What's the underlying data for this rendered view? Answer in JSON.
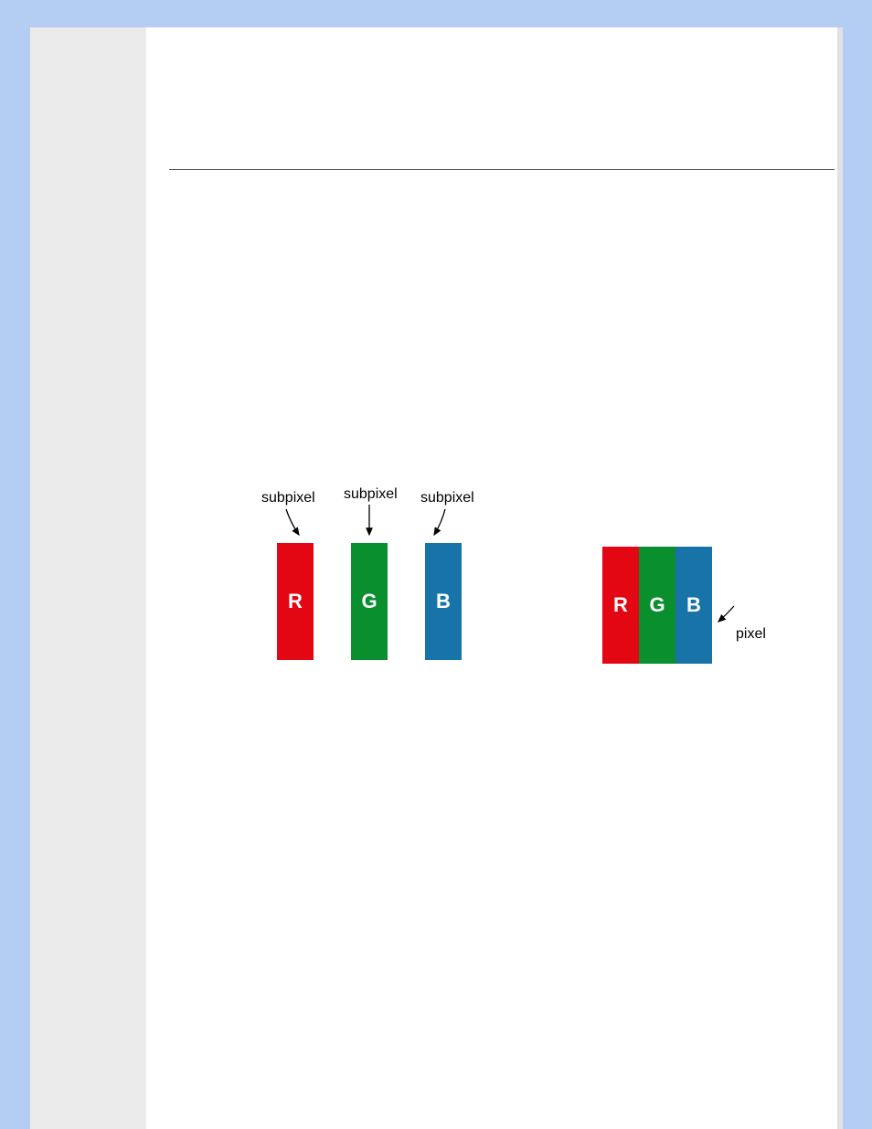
{
  "diagram": {
    "subpixel_label_r": "subpixel",
    "subpixel_label_g": "subpixel",
    "subpixel_label_b": "subpixel",
    "pixel_label": "pixel",
    "letters": {
      "r": "R",
      "g": "G",
      "b": "B"
    },
    "colors": {
      "r": "#e30613",
      "g": "#0a8f2f",
      "b": "#1874a8"
    }
  }
}
